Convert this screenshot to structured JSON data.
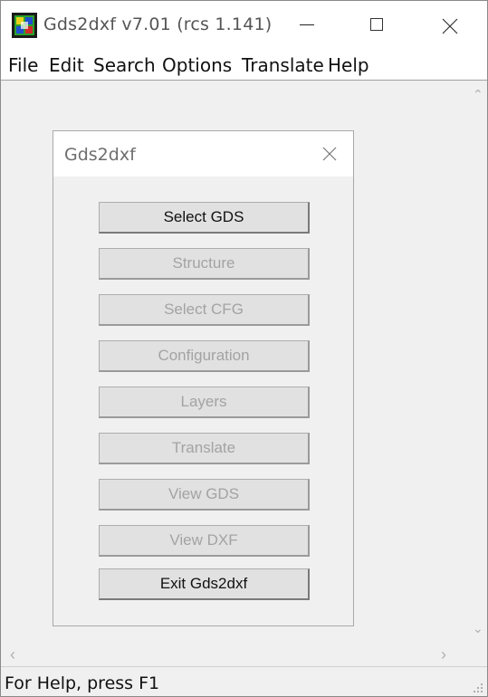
{
  "window": {
    "title": "Gds2dxf v7.01 (rcs 1.141)"
  },
  "menu": {
    "items": [
      {
        "label": "File"
      },
      {
        "label": "Edit"
      },
      {
        "label": "Search"
      },
      {
        "label": "Options"
      },
      {
        "label": "Translate"
      },
      {
        "label": "Help"
      }
    ]
  },
  "dialog": {
    "title": "Gds2dxf",
    "buttons": [
      {
        "label": "Select GDS",
        "enabled": true
      },
      {
        "label": "Structure",
        "enabled": false
      },
      {
        "label": "Select CFG",
        "enabled": false
      },
      {
        "label": "Configuration",
        "enabled": false
      },
      {
        "label": "Layers",
        "enabled": false
      },
      {
        "label": "Translate",
        "enabled": false
      },
      {
        "label": "View GDS",
        "enabled": false
      },
      {
        "label": "View DXF",
        "enabled": false
      },
      {
        "label": "Exit Gds2dxf",
        "enabled": true
      }
    ]
  },
  "status": {
    "text": "For Help, press F1"
  },
  "colors": {
    "window_bg": "#f0f0f0",
    "disabled_text": "#a3a3a3",
    "button_face": "#e1e1e1"
  }
}
